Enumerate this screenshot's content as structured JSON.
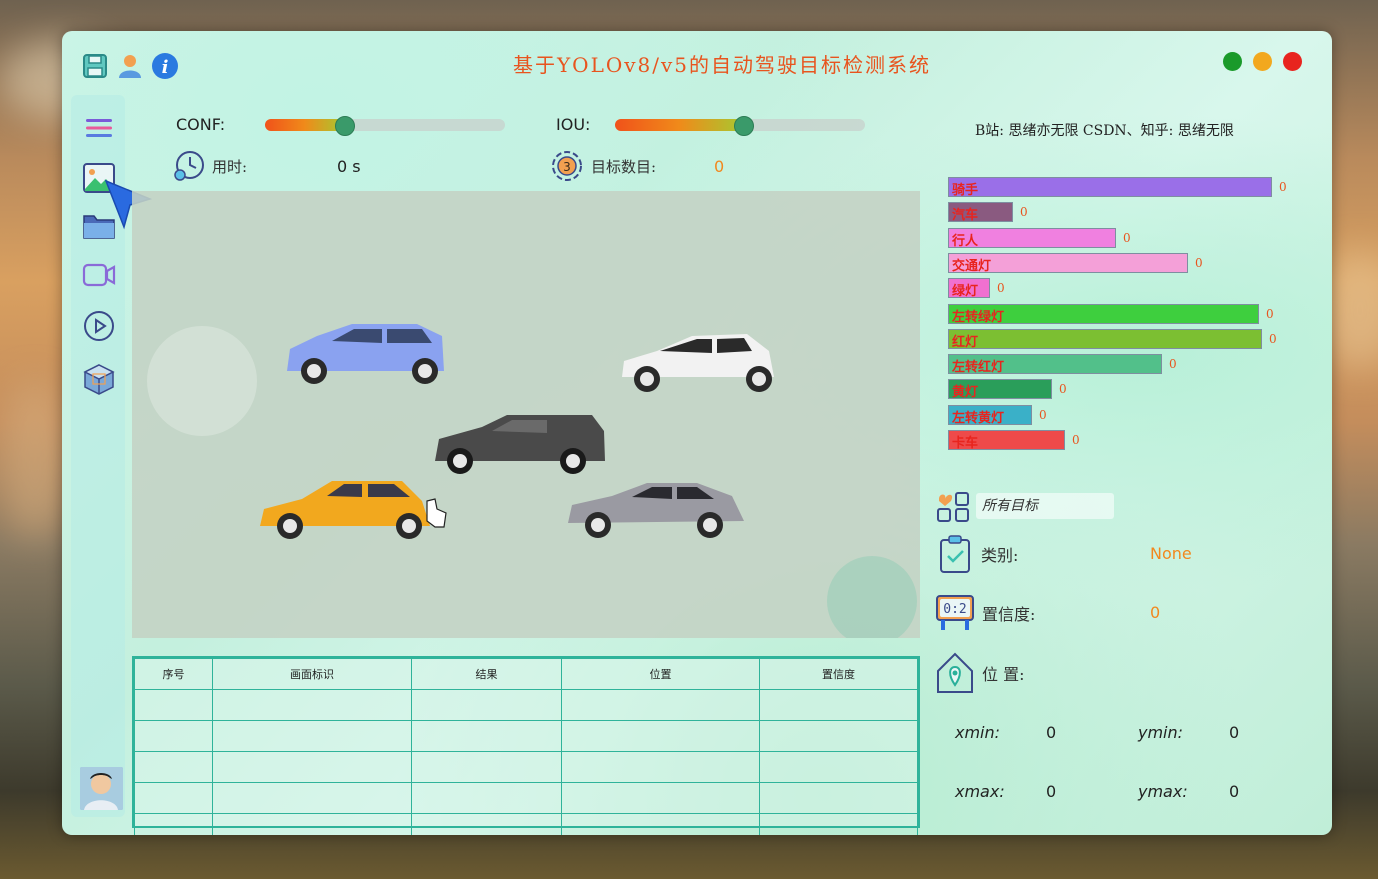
{
  "window": {
    "title": "基于YOLOv8/v5的自动驾驶目标检测系统",
    "traffic_lights": [
      "#1a9a2a",
      "#f2a81e",
      "#e8241e"
    ]
  },
  "sidebar": {
    "items": [
      {
        "icon": "menu-icon"
      },
      {
        "icon": "image-icon"
      },
      {
        "icon": "folder-icon"
      },
      {
        "icon": "video-camera-icon"
      },
      {
        "icon": "play-icon"
      },
      {
        "icon": "model-cube-icon"
      }
    ]
  },
  "controls": {
    "conf_label": "CONF:",
    "conf_value": 0.33,
    "iou_label": "IOU:",
    "iou_value": 0.51,
    "time_label": "用时:",
    "time_value": "0 s",
    "count_label": "目标数目:",
    "count_value": "0",
    "credit": "B站: 思绪亦无限 CSDN、知乎: 思绪无限"
  },
  "table": {
    "headers": [
      "序号",
      "画面标识",
      "结果",
      "位置",
      "置信度"
    ],
    "rows": [
      [
        "",
        "",
        "",
        "",
        ""
      ],
      [
        "",
        "",
        "",
        "",
        ""
      ],
      [
        "",
        "",
        "",
        "",
        ""
      ],
      [
        "",
        "",
        "",
        "",
        ""
      ],
      [
        "",
        "",
        "",
        "",
        ""
      ]
    ]
  },
  "class_bars": [
    {
      "label": "骑手",
      "value": "0",
      "level": 1.0,
      "color": "#9a6fe8"
    },
    {
      "label": "汽车",
      "value": "0",
      "level": 0.2,
      "color": "#8a5a80"
    },
    {
      "label": "行人",
      "value": "0",
      "level": 0.52,
      "color": "#f080e0"
    },
    {
      "label": "交通灯",
      "value": "0",
      "level": 0.74,
      "color": "#f4a0d8"
    },
    {
      "label": "绿灯",
      "value": "0",
      "level": 0.13,
      "color": "#f070d0"
    },
    {
      "label": "左转绿灯",
      "value": "0",
      "level": 0.96,
      "color": "#3ecf3e"
    },
    {
      "label": "红灯",
      "value": "0",
      "level": 0.97,
      "color": "#7cbf32"
    },
    {
      "label": "左转红灯",
      "value": "0",
      "level": 0.66,
      "color": "#52c08a"
    },
    {
      "label": "黄灯",
      "value": "0",
      "level": 0.32,
      "color": "#2a9e5a"
    },
    {
      "label": "左转黄灯",
      "value": "0",
      "level": 0.26,
      "color": "#3ab0c8"
    },
    {
      "label": "卡车",
      "value": "0",
      "level": 0.36,
      "color": "#ee4a4a"
    }
  ],
  "info": {
    "target_select": "所有目标",
    "class_label": "类别:",
    "class_value": "None",
    "conf_label": "置信度:",
    "conf_value": "0",
    "pos_label": "位 置:",
    "xmin_label": "xmin:",
    "xmin": "0",
    "ymin_label": "ymin:",
    "ymin": "0",
    "xmax_label": "xmax:",
    "xmax": "0",
    "ymax_label": "ymax:",
    "ymax": "0"
  }
}
